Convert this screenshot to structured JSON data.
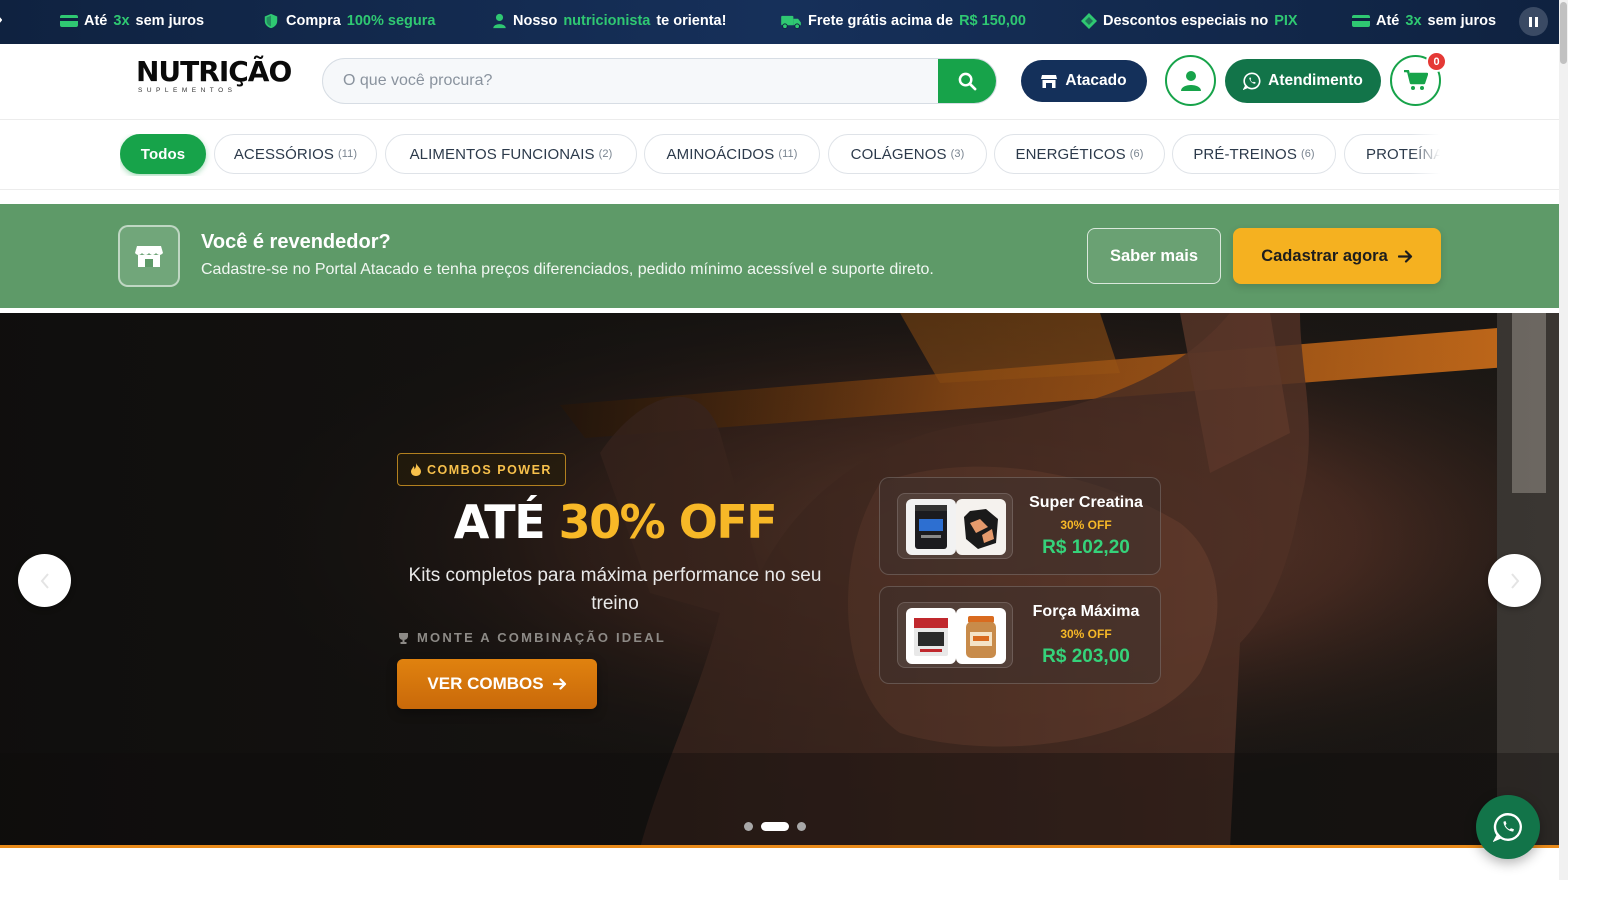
{
  "ticker": {
    "items": [
      {
        "icon": "card-icon",
        "pre": "Até",
        "hl": "3x",
        "post": "sem juros"
      },
      {
        "icon": "shield-icon",
        "pre": "Compra",
        "hl": "100% segura",
        "post": ""
      },
      {
        "icon": "nutritionist-icon",
        "pre": "Nosso",
        "hl": "nutricionista",
        "post": "te orienta!"
      },
      {
        "icon": "truck-icon",
        "pre": "Frete grátis acima de",
        "hl": "R$ 150,00",
        "post": ""
      },
      {
        "icon": "pix-icon",
        "pre": "Descontos especiais no",
        "hl": "PIX",
        "post": ""
      },
      {
        "icon": "card-icon",
        "pre": "Até",
        "hl": "3x",
        "post": "sem juros"
      }
    ],
    "pause_icon": "pause-icon",
    "colors": {
      "bg": "#14305a",
      "highlight": "#2fc872"
    }
  },
  "header": {
    "logo_text": "NUTRIÇÃO",
    "logo_sub": "SUPLEMENTOS",
    "search_placeholder": "O que você procura?",
    "search_icon": "search-icon",
    "atacado_label": "Atacado",
    "user_icon": "user-icon",
    "atendimento_label": "Atendimento",
    "cart_count": "0",
    "colors": {
      "green": "#17a34a",
      "navy": "#14305a",
      "dark_green": "#127449"
    }
  },
  "categories": [
    {
      "label": "Todos",
      "count": ""
    },
    {
      "label": "ACESSÓRIOS",
      "count": "(11)"
    },
    {
      "label": "ALIMENTOS FUNCIONAIS",
      "count": "(2)"
    },
    {
      "label": "AMINOÁCIDOS",
      "count": "(11)"
    },
    {
      "label": "COLÁGENOS",
      "count": "(3)"
    },
    {
      "label": "ENERGÉTICOS",
      "count": "(6)"
    },
    {
      "label": "PRÉ-TREINOS",
      "count": "(6)"
    },
    {
      "label": "PROTEÍNAS",
      "count": ""
    }
  ],
  "reseller": {
    "title": "Você é revendedor?",
    "text": "Cadastre-se no Portal Atacado e tenha preços diferenciados, pedido mínimo acessível e suporte direto.",
    "saber_mais": "Saber mais",
    "cadastrar": "Cadastrar agora",
    "colors": {
      "bg": "#5e9a68",
      "cta": "#f5b120"
    }
  },
  "hero": {
    "badge": "COMBOS POWER",
    "title_pre": "ATÉ",
    "title_accent": "30% OFF",
    "subtitle": "Kits completos para máxima performance no seu treino",
    "hint": "MONTE A COMBINAÇÃO IDEAL",
    "cta": "VER COMBOS",
    "combos": [
      {
        "name": "Super Creatina",
        "off": "30% OFF",
        "price": "R$ 102,20"
      },
      {
        "name": "Força Máxima",
        "off": "30% OFF",
        "price": "R$ 203,00"
      }
    ],
    "slides": 3,
    "active_slide": 2,
    "colors": {
      "accent": "#f7b827",
      "price": "#35d27a",
      "cta": "#d9780c"
    }
  },
  "floating": {
    "whatsapp_icon": "whatsapp-icon"
  }
}
